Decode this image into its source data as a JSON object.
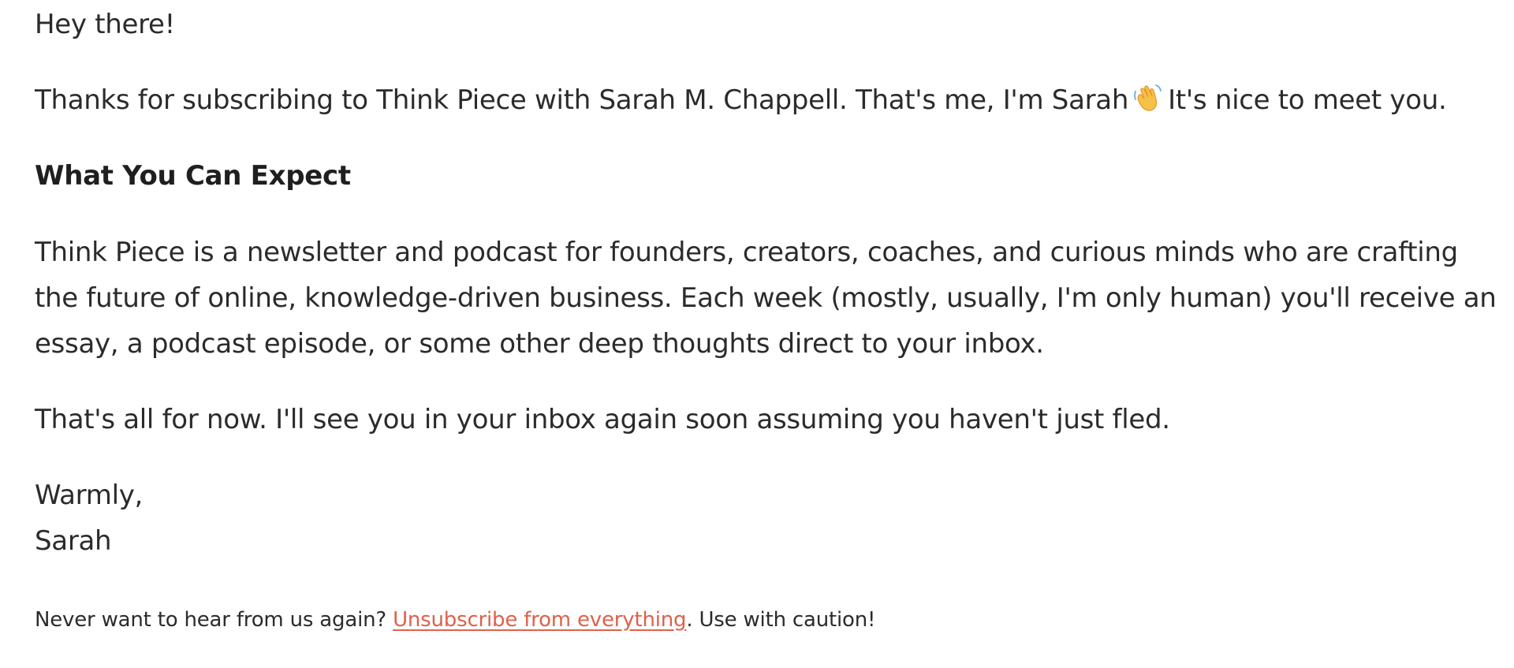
{
  "email": {
    "greeting": "Hey there!",
    "intro_before_emoji": "Thanks for subscribing to Think Piece with Sarah M. Chappell. That's me, I'm Sarah",
    "intro_after_emoji": "It's nice to meet you.",
    "emoji": "waving-hand-icon",
    "section_heading": "What You Can Expect",
    "about": "Think Piece is a newsletter and podcast for founders, creators, coaches, and curious minds who are crafting the future of online, knowledge-driven business. Each week (mostly, usually, I'm only human) you'll receive an essay, a podcast episode, or some other deep thoughts direct to your inbox.",
    "closing": "That's all for now. I'll see you in your inbox again soon assuming you haven't just fled.",
    "signoff": "Warmly,",
    "signature": "Sarah"
  },
  "footer": {
    "prefix": "Never want to hear from us again?",
    "unsubscribe_link": "Unsubscribe from everything",
    "suffix": ". Use with caution!"
  },
  "colors": {
    "text": "#2b2b2b",
    "link": "#e0604a",
    "background": "#ffffff"
  }
}
